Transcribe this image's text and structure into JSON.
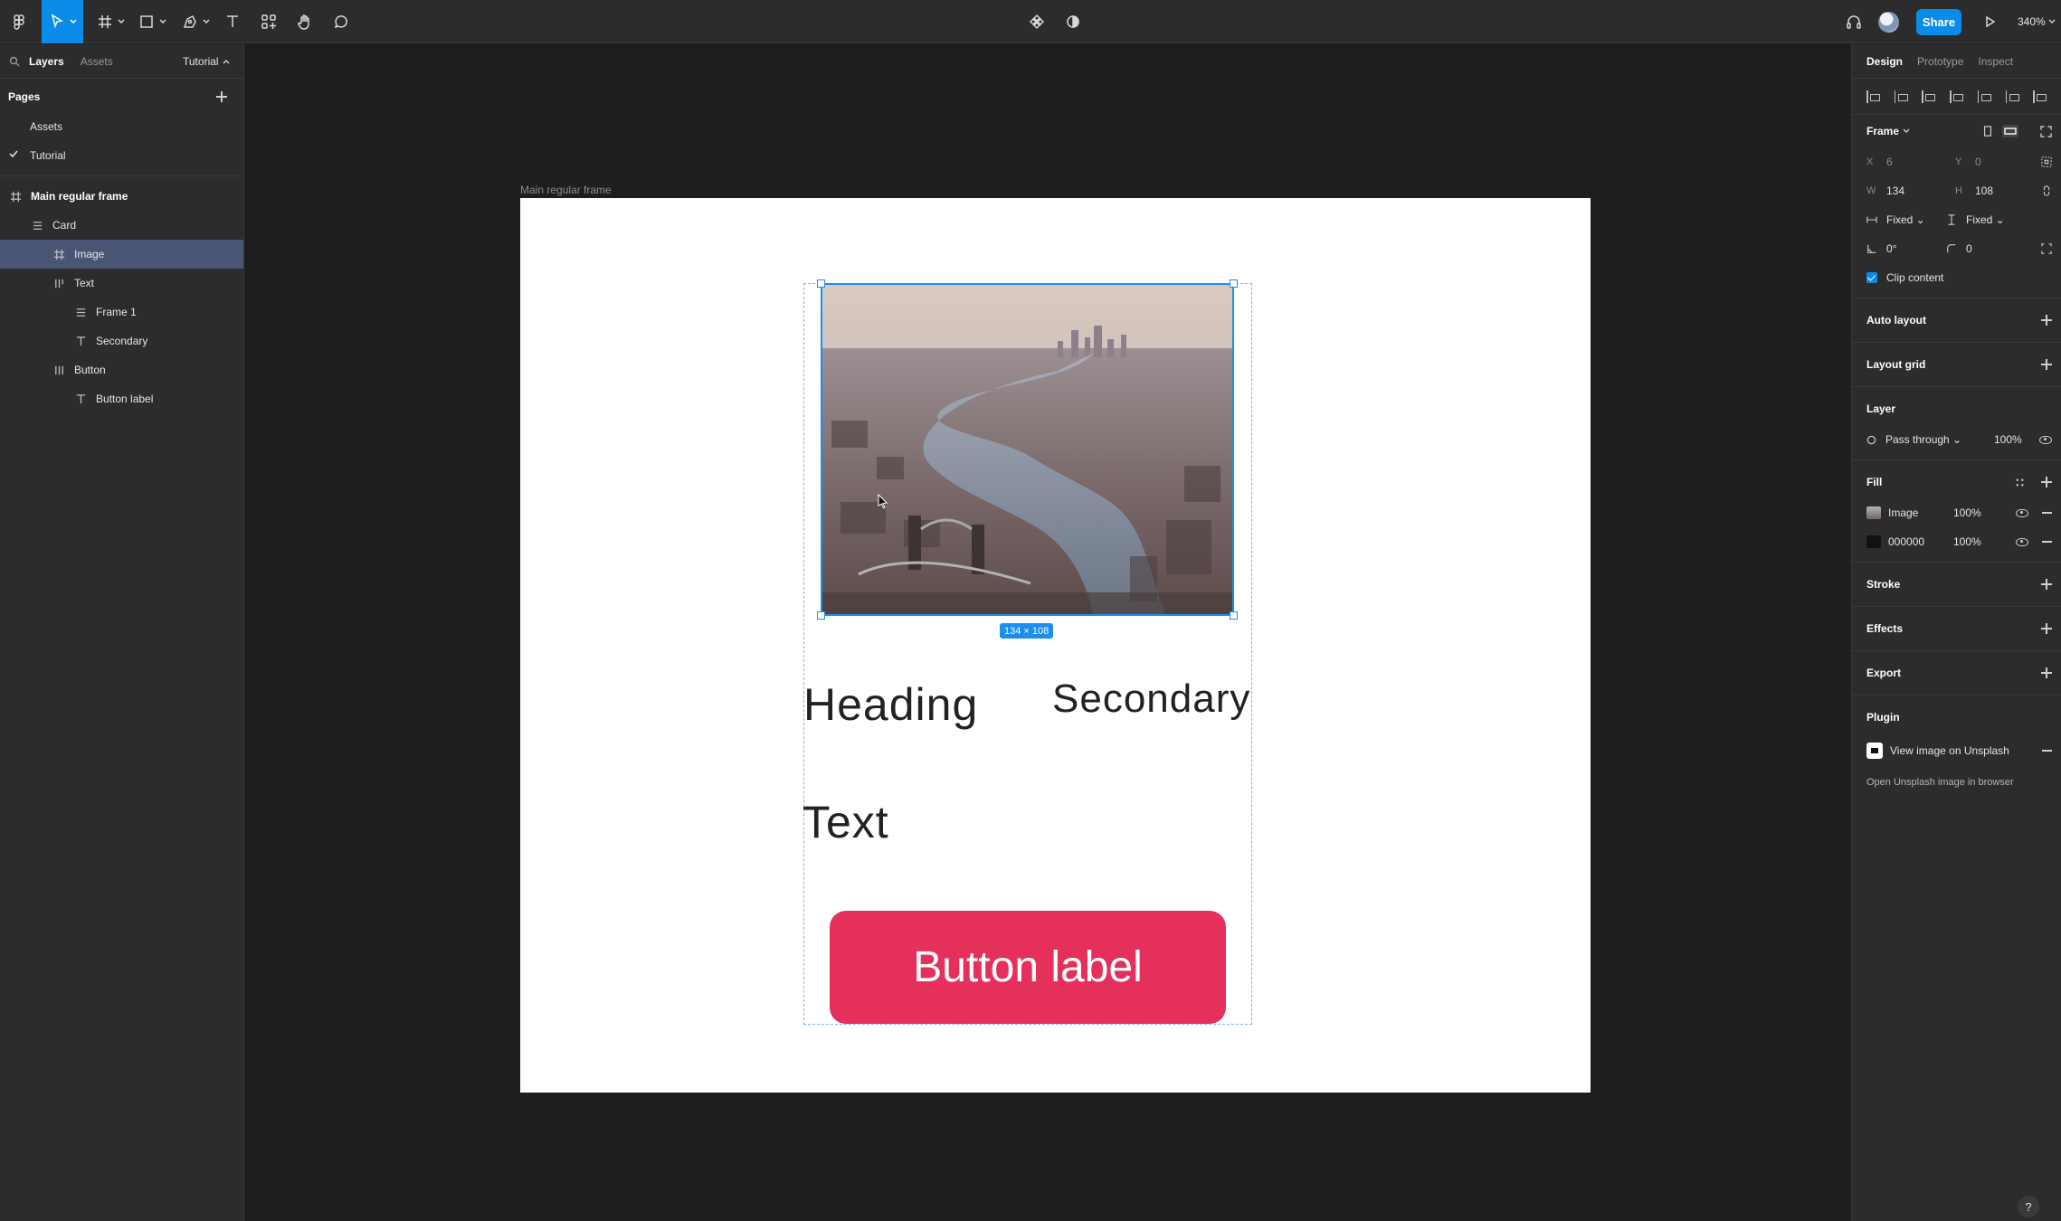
{
  "toolbar": {
    "share_label": "Share",
    "zoom": "340%"
  },
  "left_panel": {
    "tabs": [
      "Layers",
      "Assets"
    ],
    "current_page": "Tutorial",
    "pages_title": "Pages",
    "pages": [
      {
        "label": "Assets",
        "checked": false
      },
      {
        "label": "Tutorial",
        "checked": true
      }
    ],
    "layers": [
      {
        "label": "Main regular frame",
        "icon": "frame-icon",
        "indent": 0
      },
      {
        "label": "Card",
        "icon": "autolayout-vertical-icon",
        "indent": 1
      },
      {
        "label": "Image",
        "icon": "frame-icon",
        "indent": 2,
        "selected": true
      },
      {
        "label": "Text",
        "icon": "autolayout-horizontal-icon",
        "indent": 2
      },
      {
        "label": "Frame 1",
        "icon": "autolayout-vertical-icon",
        "indent": 3
      },
      {
        "label": "Secondary",
        "icon": "text-icon",
        "indent": 3
      },
      {
        "label": "Button",
        "icon": "autolayout-horizontal-icon",
        "indent": 2
      },
      {
        "label": "Button label",
        "icon": "text-icon",
        "indent": 3
      }
    ]
  },
  "canvas": {
    "frame_label": "Main regular frame",
    "dimension_badge": "134 × 108",
    "heading": "Heading",
    "secondary": "Secondary",
    "body_text": "Text",
    "button_label": "Button label"
  },
  "right_panel": {
    "tabs": [
      "Design",
      "Prototype",
      "Inspect"
    ],
    "frame": {
      "title": "Frame",
      "x_label": "X",
      "x": "6",
      "y_label": "Y",
      "y": "0",
      "w_label": "W",
      "w": "134",
      "h_label": "H",
      "h": "108",
      "horizontal_resizing": "Fixed",
      "vertical_resizing": "Fixed",
      "rotation": "0°",
      "corner_radius": "0",
      "clip_content": "Clip content"
    },
    "auto_layout": "Auto layout",
    "layout_grid": "Layout grid",
    "layer": {
      "title": "Layer",
      "blend": "Pass through",
      "opacity": "100%"
    },
    "fill": {
      "title": "Fill",
      "items": [
        {
          "name": "Image",
          "opacity": "100%",
          "swatch": "#9aa3b0"
        },
        {
          "name": "000000",
          "opacity": "100%",
          "swatch": "#111111"
        }
      ]
    },
    "stroke": "Stroke",
    "effects": "Effects",
    "export": "Export",
    "plugin": {
      "title": "Plugin",
      "name": "View image on Unsplash",
      "description": "Open Unsplash image in browser"
    }
  },
  "colors": {
    "accent": "#0c8ce9",
    "button": "#e5305c",
    "selected_layer": "#4a5575"
  }
}
